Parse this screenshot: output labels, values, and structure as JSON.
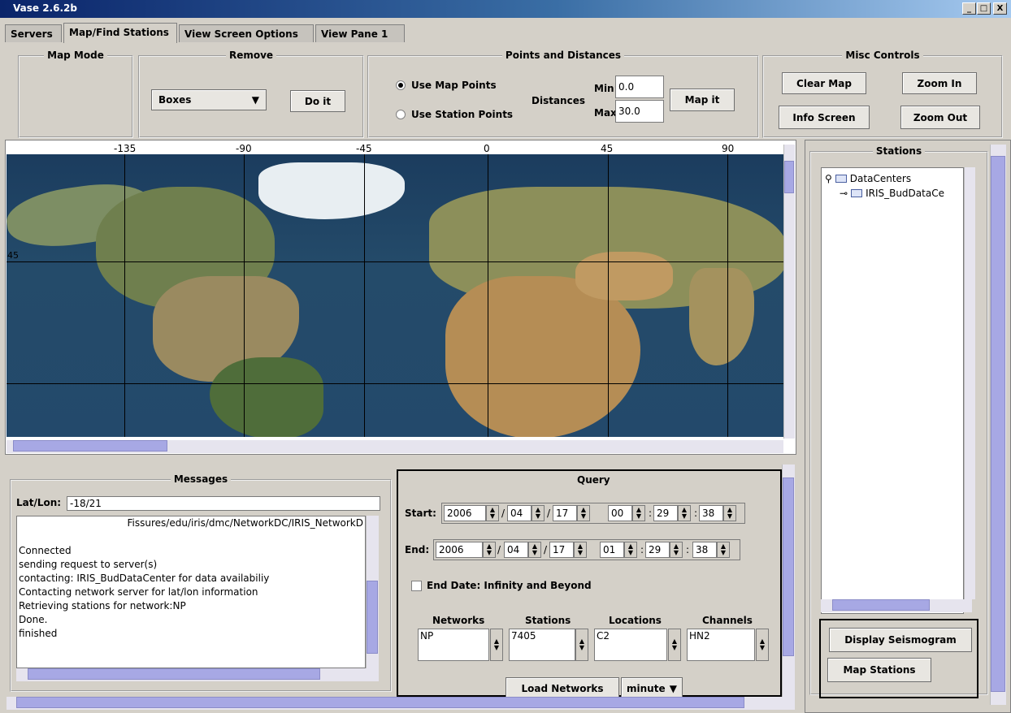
{
  "window": {
    "title": "Vase 2.6.2b",
    "min": "_",
    "max": "□",
    "close": "X"
  },
  "tabs": [
    "Servers",
    "Map/Find Stations",
    "View Screen Options",
    "View Pane 1"
  ],
  "map_mode": {
    "title": "Map Mode"
  },
  "remove": {
    "title": "Remove",
    "select_value": "Boxes",
    "button": "Do it"
  },
  "points": {
    "title": "Points and Distances",
    "radio1": "Use Map Points",
    "radio2": "Use Station Points",
    "distances_label": "Distances",
    "min_label": "Min:",
    "min_value": "0.0",
    "max_label": "Max:",
    "max_value": "30.0",
    "button": "Map it"
  },
  "misc": {
    "title": "Misc Controls",
    "clear": "Clear Map",
    "zoom_in": "Zoom In",
    "info": "Info Screen",
    "zoom_out": "Zoom Out"
  },
  "map": {
    "ticks": [
      "-135",
      "-90",
      "-45",
      "0",
      "45",
      "90"
    ],
    "lat_label": "45"
  },
  "stations": {
    "title": "Stations",
    "root": "DataCenters",
    "child": "IRIS_BudDataCe",
    "display": "Display Seismogram",
    "map": "Map Stations"
  },
  "messages": {
    "title": "Messages",
    "latlon_label": "Lat/Lon:",
    "latlon_value": "-18/21",
    "header_line": "Fissures/edu/iris/dmc/NetworkDC/IRIS_NetworkD",
    "lines": [
      "",
      "Connected",
      "sending request to server(s)",
      "contacting: IRIS_BudDataCenter  for data availabiliy",
      "Contacting network server for lat/lon information",
      "Retrieving stations for network:NP",
      "Done.",
      "finished"
    ]
  },
  "query": {
    "title": "Query",
    "start_label": "Start:",
    "start": [
      "2006",
      "04",
      "17",
      "00",
      "29",
      "38"
    ],
    "end_label": "End:",
    "end": [
      "2006",
      "04",
      "17",
      "01",
      "29",
      "38"
    ],
    "end_infinity": "End Date: Infinity and Beyond",
    "networks_label": "Networks",
    "stations_label": "Stations",
    "locations_label": "Locations",
    "channels_label": "Channels",
    "networks_value": "NP",
    "stations_value": "7405",
    "locations_value": "C2",
    "channels_value": "HN2",
    "load": "Load Networks",
    "unit": "minute"
  }
}
